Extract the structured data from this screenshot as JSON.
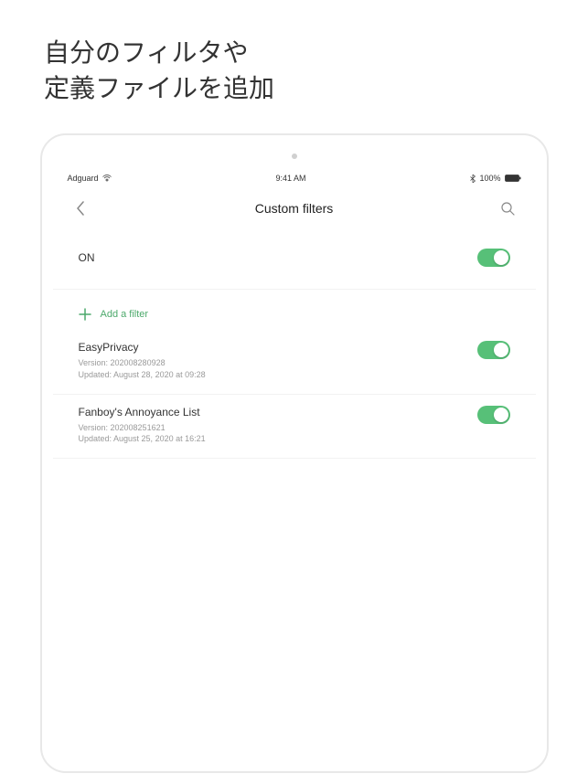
{
  "promo": {
    "line1": "自分のフィルタや",
    "line2": "定義ファイルを追加"
  },
  "statusbar": {
    "carrier": "Adguard",
    "time": "9:41 AM",
    "battery": "100%"
  },
  "nav": {
    "title": "Custom filters"
  },
  "master": {
    "label": "ON",
    "enabled": true
  },
  "add": {
    "label": "Add a filter"
  },
  "filters": [
    {
      "name": "EasyPrivacy",
      "version": "Version: 202008280928",
      "updated": "Updated: August 28, 2020 at 09:28",
      "enabled": true
    },
    {
      "name": "Fanboy's Annoyance List",
      "version": "Version: 202008251621",
      "updated": "Updated: August 25, 2020 at 16:21",
      "enabled": true
    }
  ]
}
